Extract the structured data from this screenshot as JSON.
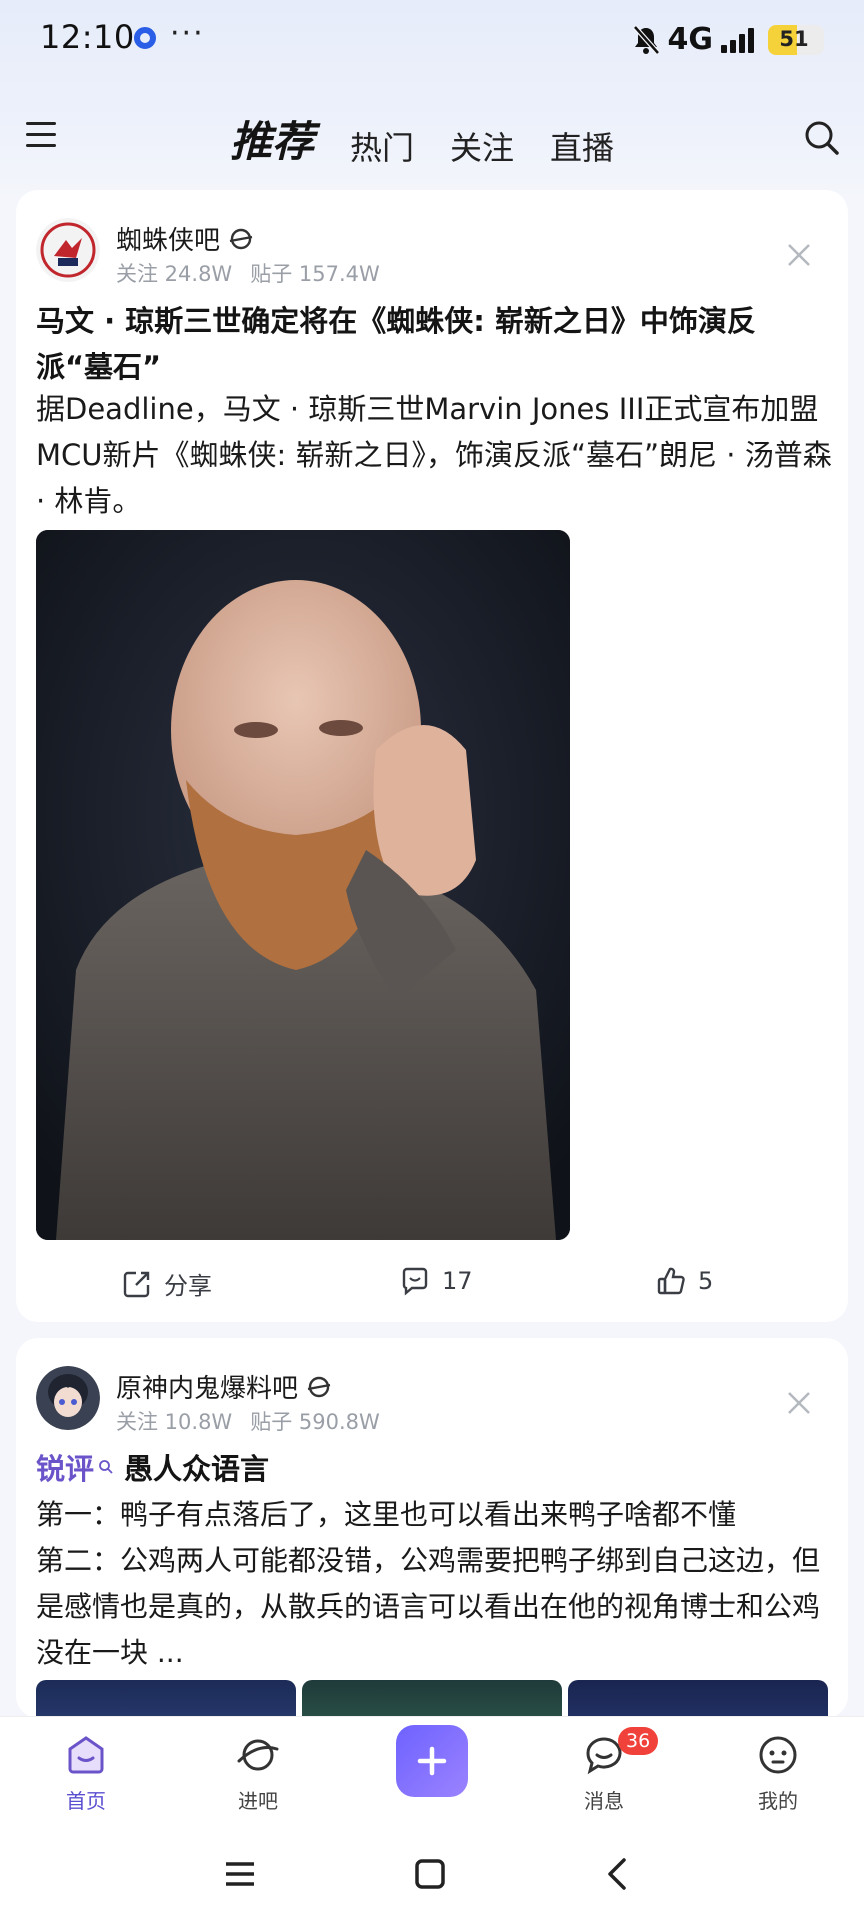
{
  "status_bar": {
    "time": "12:10",
    "network": "4G",
    "battery": "51",
    "more": "···"
  },
  "header": {
    "tabs": [
      {
        "label": "推荐",
        "active": true
      },
      {
        "label": "热门",
        "active": false
      },
      {
        "label": "关注",
        "active": false
      },
      {
        "label": "直播",
        "active": false
      }
    ]
  },
  "posts": [
    {
      "bar_name": "蜘蛛侠吧",
      "follow": "关注 24.8W",
      "posts_count": "贴子 157.4W",
      "title": "马文 · 琼斯三世确定将在《蜘蛛侠: 崭新之日》中饰演反派“墓石”",
      "body": "据Deadline，马文 · 琼斯三世Marvin Jones III正式宣布加盟MCU新片《蜘蛛侠: 崭新之日》，饰演反派“墓石”朗尼 · 汤普森 · 林肯。",
      "share_label": "分享",
      "comments": "17",
      "likes": "5"
    },
    {
      "bar_name": "原神内鬼爆料吧",
      "follow": "关注 10.8W",
      "posts_count": "贴子 590.8W",
      "tag": "锐评",
      "headline": "愚人众语言",
      "body": "第一：鸭子有点落后了，这里也可以看出来鸭子啥都不懂\n第二：公鸡两人可能都没错，公鸡需要把鸭子绑到自己这边，但是感情也是真的，从散兵的语言可以看出在他的视角博士和公鸡没在一块 ..."
    }
  ],
  "bottom_nav": {
    "home": "首页",
    "bars": "进吧",
    "messages": "消息",
    "messages_badge": "36",
    "me": "我的"
  },
  "colors": {
    "accent": "#6b54c9",
    "badge": "#f0423a",
    "plus_start": "#6e62ff",
    "plus_end": "#9b83ff"
  }
}
